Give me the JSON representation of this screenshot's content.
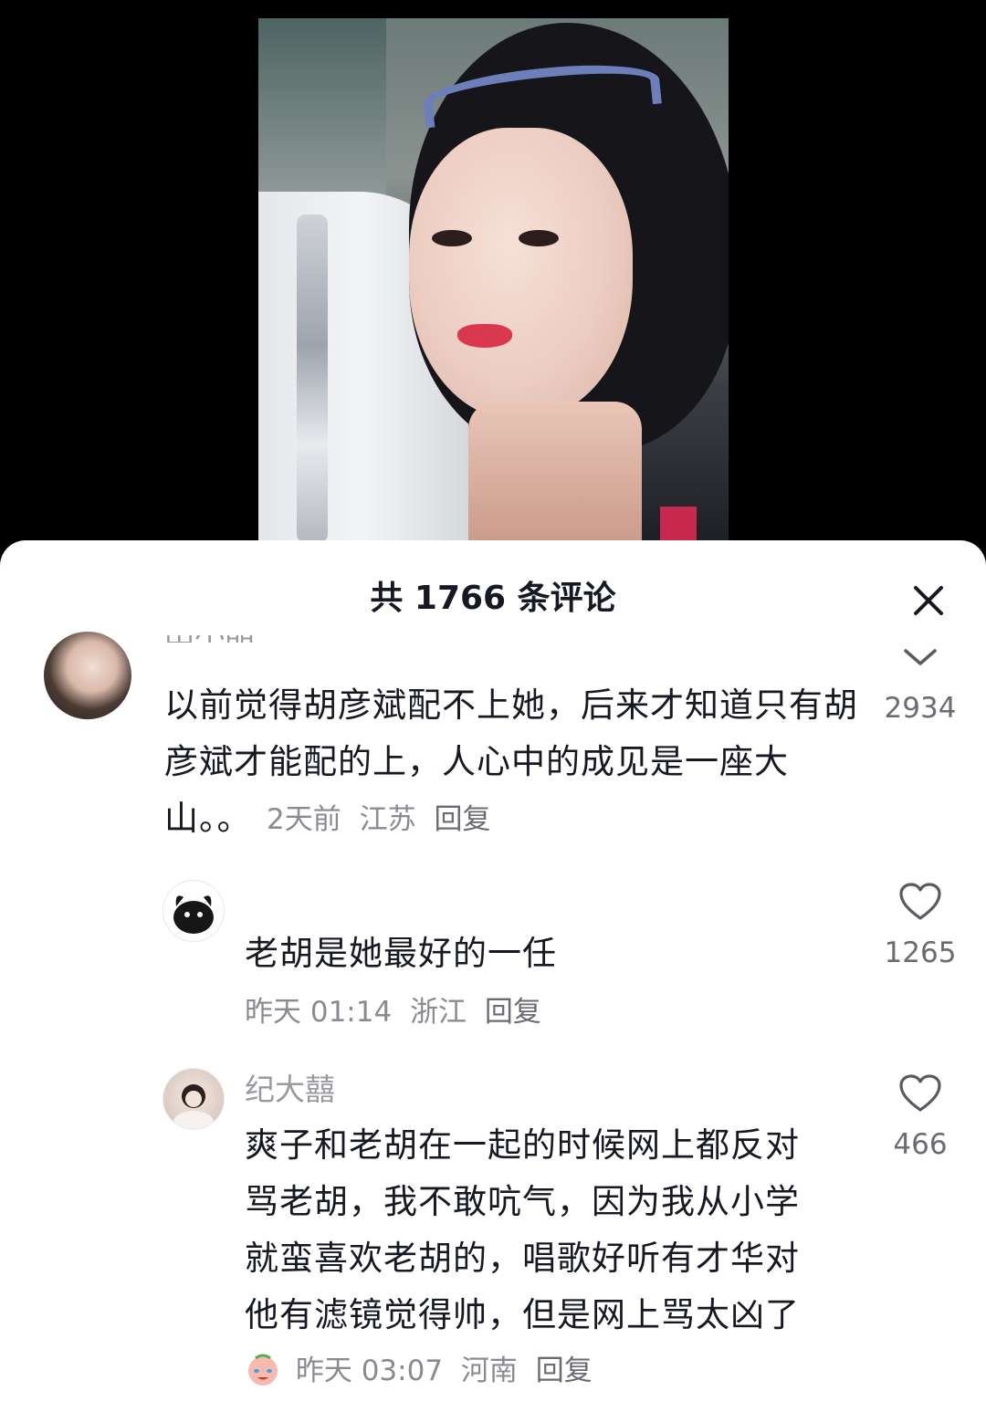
{
  "sheet": {
    "title": "共 1766 条评论"
  },
  "comments": [
    {
      "username": "田小晶",
      "text": "以前觉得胡彦斌配不上她，后来才知道只有胡彦斌才能配的上，人心中的成见是一座大山。。",
      "time": "2天前",
      "location": "江苏",
      "reply_label": "回复",
      "likes": "2934"
    },
    {
      "username": "",
      "text": "老胡是她最好的一任",
      "time": "昨天 01:14",
      "location": "浙江",
      "reply_label": "回复",
      "likes": "1265"
    },
    {
      "username": "纪大囍",
      "text": "爽子和老胡在一起的时候网上都反对骂老胡，我不敢吭气，因为我从小学就蛮喜欢老胡的，唱歌好听有才华对他有滤镜觉得帅，但是网上骂太凶了",
      "time": "昨天 03:07",
      "location": "河南",
      "reply_label": "回复",
      "likes": "466"
    }
  ],
  "icons": {
    "close": "close-icon",
    "like": "heart-outline-icon",
    "collapse": "chevron-down-icon",
    "emoji": "crying-emoji-icon"
  },
  "colors": {
    "primary_text": "#161823",
    "secondary_text": "#8a8a92",
    "icon_gray": "#5a5a62"
  }
}
